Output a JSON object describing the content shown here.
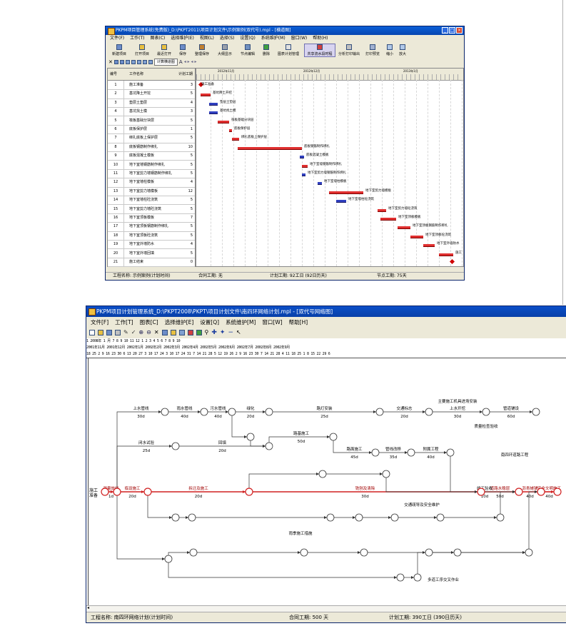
{
  "top_window": {
    "title": "PKPM项目管理系统(免费版)_D:\\PKPT2011\\项目计划文件\\示例案例(双代号).mpl - [横道图]",
    "menu": [
      "文件(F)",
      "工作(T)",
      "图表(C)",
      "选择维护(E)",
      "视图(L)",
      "选择(S)",
      "设置(Q)",
      "系统维护(M)",
      "窗口(W)",
      "帮助(H)"
    ],
    "toolbar": [
      "新建项目",
      "打开项目",
      "最近打开",
      "保存",
      "整理保存",
      "大纲显示",
      "节点编辑",
      "删除",
      "图表计划管理",
      "共享流水段时程",
      "分析打印输出",
      "打印预览",
      "缩小",
      "放大"
    ],
    "view_select": "计算横道图",
    "timescale": {
      "months": [
        "2012年11月",
        "2012年12月",
        "2013年1月"
      ]
    },
    "grid_headers": {
      "num": "编号",
      "name": "工作名称",
      "dur": "计划工期"
    },
    "tasks": [
      {
        "num": "1",
        "name": "施工准备",
        "dur": "3"
      },
      {
        "num": "2",
        "name": "基坑降土开挖",
        "dur": "5"
      },
      {
        "num": "3",
        "name": "垫层土垫层",
        "dur": "4"
      },
      {
        "num": "4",
        "name": "基坑找土模",
        "dur": "3"
      },
      {
        "num": "5",
        "name": "筏板基础分块层",
        "dur": "5"
      },
      {
        "num": "6",
        "name": "底板保护层",
        "dur": "1"
      },
      {
        "num": "7",
        "name": "绑扎底板上保护层",
        "dur": "5"
      },
      {
        "num": "8",
        "name": "底板钢筋制作绑扎",
        "dur": "10"
      },
      {
        "num": "9",
        "name": "底板混凝土模板",
        "dur": "5"
      },
      {
        "num": "10",
        "name": "地下室墙钢筋制作绑扎",
        "dur": "5"
      },
      {
        "num": "11",
        "name": "地下室剪力墙钢筋制作绑扎",
        "dur": "5"
      },
      {
        "num": "12",
        "name": "地下室墙柱模板",
        "dur": "4"
      },
      {
        "num": "13",
        "name": "地下室剪力墙模板",
        "dur": "12"
      },
      {
        "num": "14",
        "name": "地下室墙柱砼浇筑",
        "dur": "5"
      },
      {
        "num": "15",
        "name": "地下室剪力墙砼浇筑",
        "dur": "5"
      },
      {
        "num": "16",
        "name": "地下室顶板模板",
        "dur": "7"
      },
      {
        "num": "17",
        "name": "地下室顶板钢筋制作绑扎",
        "dur": "5"
      },
      {
        "num": "18",
        "name": "地下室顶板砼浇筑",
        "dur": "5"
      },
      {
        "num": "19",
        "name": "地下室外墙防水",
        "dur": "4"
      },
      {
        "num": "20",
        "name": "地下室外墙回填",
        "dur": "5"
      },
      {
        "num": "21",
        "name": "施工结束",
        "dur": "0"
      }
    ],
    "bar_labels": [
      "施工准备",
      "基坑降土开挖",
      "垫层土垫层",
      "基坑找土模",
      "筏板基础分块层",
      "底板保护层",
      "绑扎底板上保护层",
      "底板钢筋制作绑扎",
      "底板混凝土模板",
      "地下室墙钢筋制作绑扎",
      "地下室剪力墙钢筋制作绑扎",
      "地下室墙柱模板",
      "地下室剪力墙模板",
      "地下室墙柱砼浇筑",
      "地下室剪力墙砼浇筑",
      "地下室顶板模板",
      "地下室顶板钢筋制作绑扎",
      "地下室顶板砼浇筑",
      "地下室外墙防水",
      "施工"
    ],
    "status": {
      "project": "工程名称: 示例案例(计划时间)",
      "contract": "合同工期: 无",
      "plan": "计划工期: 92工日 (92日历天)",
      "work": "节点工期: 75天"
    }
  },
  "bottom_window": {
    "title": "PKPM项目计划管理系统_D:\\PKPT2008\\PKPT\\项目计划文件\\南四环网络计划.mpl - [双代号网络图]",
    "menu": [
      "文件[F]",
      "工作[T]",
      "图表[C]",
      "选择维护[E]",
      "设置[Q]",
      "系统维护[M]",
      "窗口[W]",
      "帮助[H]"
    ],
    "scale_row1": "1  2008年  1  月  7  8  9  10  11  12  1  2  3  4  5  6  7  8  9  10",
    "scale_row2": "2001年11月     2001年12月     2002年1月     2002年2月     2002年3月     2002年4月     2002年5月     2002年6月     2002年7月     2002年8月     2002年9月",
    "scale_row3": "18 25 2 9 16 23 30 6 13 20 27 3 10 17 24 3 10 17 24 31 7 14 21 28 5 12 19 26 2 9 16 23 30 7 14 21 28 4 11 18 25 1 8 15 22 29 6",
    "left_label": "施工准备",
    "status": {
      "project": "工程名称: 南四环网络计划(计划时间)",
      "contract": "合同工期: 500 天",
      "plan": "计划工期: 390工日 (390日历天)"
    },
    "activities": [
      {
        "label": "测量放线",
        "dur": "1d"
      },
      {
        "label": "临设施工",
        "dur": "20d"
      },
      {
        "label": "拆迁及施工",
        "dur": "20d"
      },
      {
        "label": "铣刨及清除",
        "dur": "30d"
      },
      {
        "label": "道路水稳层",
        "dur": "50d"
      },
      {
        "label": "沥青摊铺",
        "dur": "40d"
      },
      {
        "label": "安全文明施工",
        "dur": "40d"
      },
      {
        "label": "上水管线",
        "dur": "30d"
      },
      {
        "label": "雨水管线",
        "dur": "40d"
      },
      {
        "label": "污水管线",
        "dur": "40d"
      },
      {
        "label": "绿化",
        "dur": "20d"
      },
      {
        "label": "路灯安装",
        "dur": "25d"
      },
      {
        "label": "交通标志",
        "dur": "20d"
      },
      {
        "label": "上水开挖",
        "dur": "30d"
      },
      {
        "label": "管道铺设",
        "dur": "60d"
      },
      {
        "label": "闭水试验",
        "dur": "25d"
      },
      {
        "label": "回填",
        "dur": "20d"
      },
      {
        "label": "路基施工",
        "dur": "50d"
      },
      {
        "label": "路面施工",
        "dur": "45d"
      },
      {
        "label": "管线改移",
        "dur": "35d"
      },
      {
        "label": "附属工程",
        "dur": "40d"
      },
      {
        "label": "竣工验收",
        "dur": "10d"
      }
    ],
    "labels_extra": [
      "主要施工机具进场安装",
      "南四环道路工程",
      "多道工序交叉作业",
      "交通疏导及安全维护",
      "雨季施工措施",
      "质量检查验收"
    ]
  }
}
